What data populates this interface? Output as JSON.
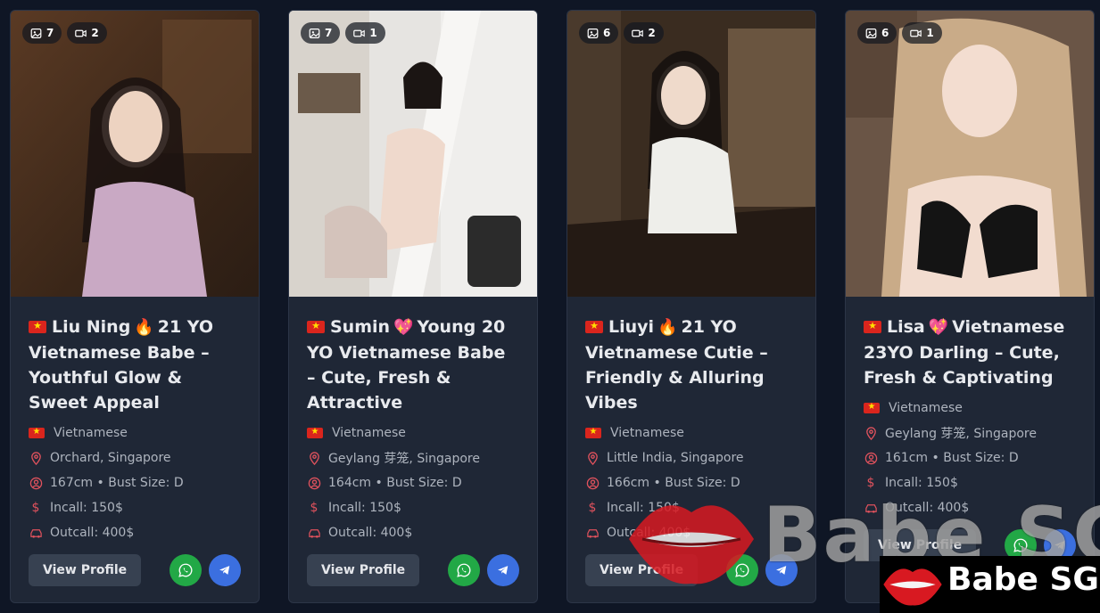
{
  "colors": {
    "page_bg": "#0f1625",
    "card_bg": "#1f2736",
    "accent_icon": "#e0525d",
    "whatsapp": "#22a846",
    "telegram": "#3b6fe0"
  },
  "cards": [
    {
      "photos": "7",
      "videos": "2",
      "title_name": "Liu Ning",
      "title_emoji": "🔥",
      "title_rest": "21 YO Vietnamese Babe – Youthful Glow & Sweet Appeal",
      "nationality": "Vietnamese",
      "location": "Orchard, Singapore",
      "stats": "167cm • Bust Size: D",
      "incall": "Incall: 150$",
      "outcall": "Outcall: 400$",
      "view_label": "View Profile"
    },
    {
      "photos": "7",
      "videos": "1",
      "title_name": "Sumin",
      "title_emoji": "💖",
      "title_rest": "Young 20 YO Vietnamese Babe – Cute, Fresh & Attractive",
      "nationality": "Vietnamese",
      "location": "Geylang 芽笼, Singapore",
      "stats": "164cm • Bust Size: D",
      "incall": "Incall: 150$",
      "outcall": "Outcall: 400$",
      "view_label": "View Profile"
    },
    {
      "photos": "6",
      "videos": "2",
      "title_name": "Liuyi",
      "title_emoji": "🔥",
      "title_rest": "21 YO Vietnamese Cutie – Friendly & Alluring Vibes",
      "nationality": "Vietnamese",
      "location": "Little India, Singapore",
      "stats": "166cm • Bust Size: D",
      "incall": "Incall: 150$",
      "outcall": "Outcall: 400$",
      "view_label": "View Profile"
    },
    {
      "photos": "6",
      "videos": "1",
      "title_name": "Lisa",
      "title_emoji": "💖",
      "title_rest": "Vietnamese 23YO Darling – Cute, Fresh & Captivating",
      "nationality": "Vietnamese",
      "location": "Geylang 芽笼, Singapore",
      "stats": "161cm • Bust Size: D",
      "incall": "Incall: 150$",
      "outcall": "Outcall: 400$",
      "view_label": "View Profile"
    }
  ],
  "watermark": {
    "text": "Babe SG",
    "logo_text": "Babe SG"
  }
}
